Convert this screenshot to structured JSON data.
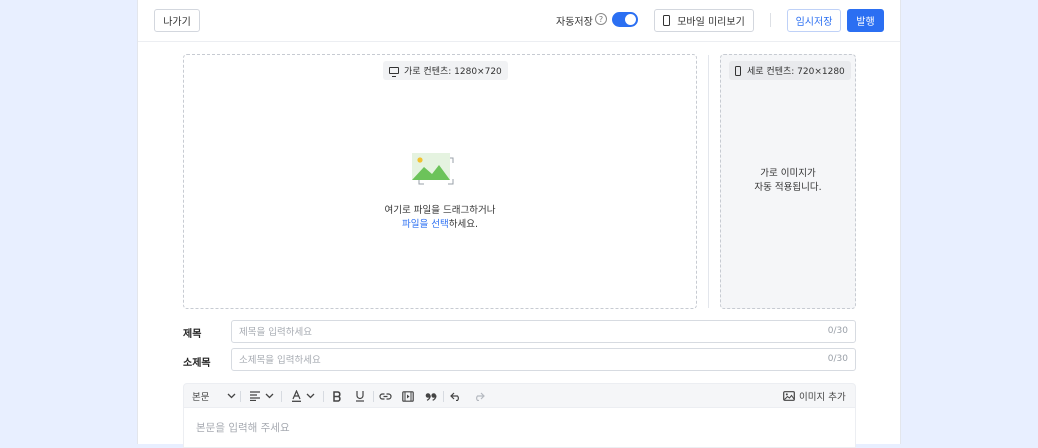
{
  "topbar": {
    "exit_label": "나가기",
    "autosave_label": "자동저장",
    "autosave_on": true,
    "mobile_preview_label": "모바일 미리보기",
    "draft_label": "임시저장",
    "publish_label": "발행"
  },
  "upload": {
    "horizontal_pill": "가로 컨텐츠: 1280×720",
    "drop_line1": "여기로 파일을 드래그하거나",
    "drop_link": "파일을 선택",
    "drop_line2_suffix": "하세요.",
    "vertical_pill": "세로 컨텐츠: 720×1280",
    "vertical_line1": "가로 이미지가",
    "vertical_line2": "자동 적용됩니다."
  },
  "fields": {
    "title_label": "제목",
    "title_placeholder": "제목을 입력하세요",
    "title_counter": "0/30",
    "subtitle_label": "소제목",
    "subtitle_placeholder": "소제목을 입력하세요",
    "subtitle_counter": "0/30"
  },
  "toolbar": {
    "paragraph_style": "본문",
    "add_image_label": "이미지 추가"
  },
  "editor": {
    "placeholder": "본문을 입력해 주세요"
  },
  "colors": {
    "accent": "#2b6ff2",
    "background": "#e8efff"
  }
}
